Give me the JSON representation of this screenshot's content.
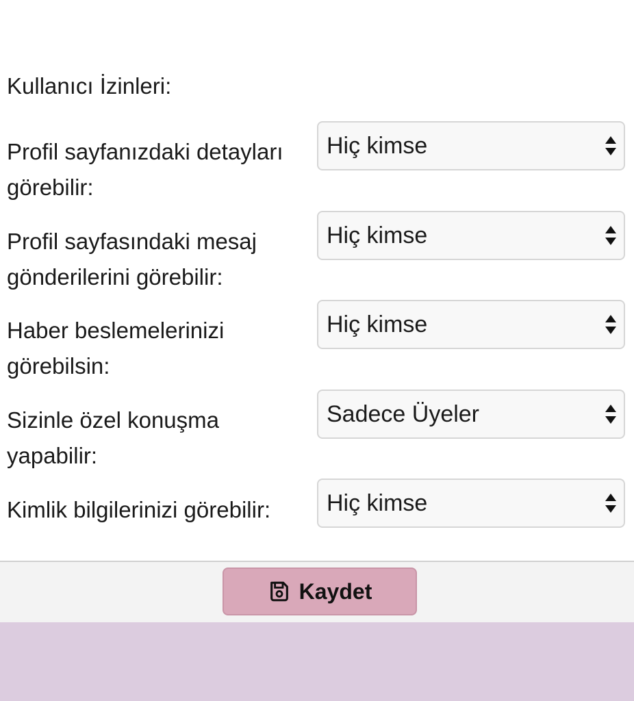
{
  "section": {
    "title": "Kullanıcı İzinleri:"
  },
  "permissions": [
    {
      "label": "Profil sayfanızdaki detayları görebilir:",
      "value": "Hiç kimse",
      "icon": "updown-icon"
    },
    {
      "label": "Profil sayfasındaki mesaj gönderilerini görebilir:",
      "value": "Hiç kimse",
      "icon": "updown-icon"
    },
    {
      "label": "Haber beslemelerinizi görebilsin:",
      "value": "Hiç kimse",
      "icon": "updown-icon"
    },
    {
      "label": "Sizinle özel konuşma yapabilir:",
      "value": "Sadece Üyeler",
      "icon": "updown-icon"
    },
    {
      "label": "Kimlik bilgilerinizi görebilir:",
      "value": "Hiç kimse",
      "icon": "updown-icon"
    }
  ],
  "footer": {
    "save_label": "Kaydet",
    "save_icon": "floppy-disk-icon",
    "button_color": "#d9a8b9",
    "bottom_band_color": "#dcccdf"
  }
}
